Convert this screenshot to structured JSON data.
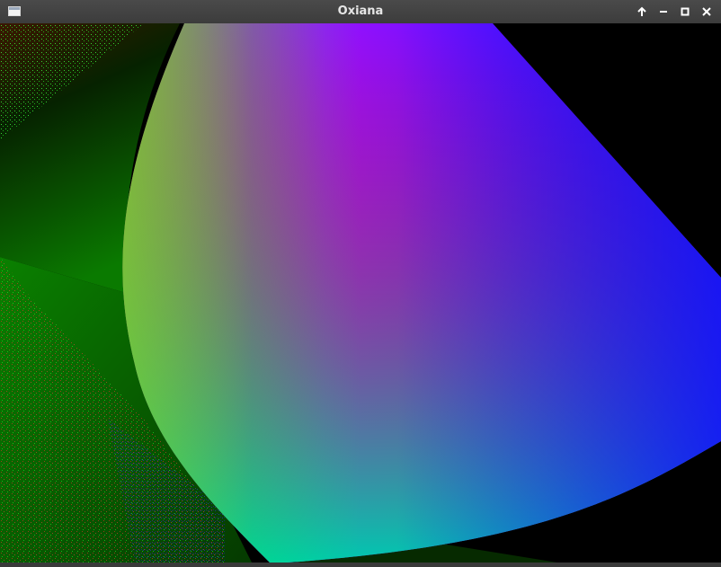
{
  "window": {
    "title": "Oxiana",
    "app_icon": "window-icon",
    "controls": [
      {
        "name": "keep-above-button",
        "icon": "arrow-up-icon"
      },
      {
        "name": "minimize-button",
        "icon": "minimize-icon"
      },
      {
        "name": "maximize-button",
        "icon": "maximize-icon"
      },
      {
        "name": "close-button",
        "icon": "close-icon"
      }
    ]
  },
  "colors": {
    "titlebar": "#444444",
    "title_text": "#e6e6e6",
    "background": "#000000",
    "shape_red": "#ff3a2a",
    "shape_magenta": "#b020c8",
    "shape_blue": "#1a1aff",
    "shape_green": "#10f070",
    "left_green": "#0a8a00"
  }
}
